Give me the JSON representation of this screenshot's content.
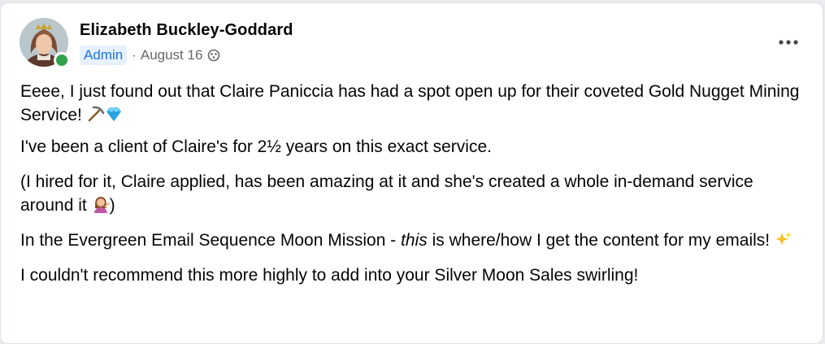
{
  "post": {
    "author": {
      "name": "Elizabeth Buckley-Goddard",
      "role_badge": "Admin",
      "date": "August 16",
      "separator": "·"
    },
    "paragraphs": {
      "p1": {
        "text": "Eeee, I just found out that Claire Paniccia has had a spot open up for their coveted Gold Nugget Mining Service!",
        "emojis": [
          "pick-icon",
          "gem-icon"
        ]
      },
      "p2": {
        "text": "I've been a client of Claire's for 2½ years on this exact service."
      },
      "p3": {
        "text": "(I hired for it, Claire applied, has been amazing at it and she's created a whole in-demand service around it",
        "close": ")",
        "emojis": [
          "woman-tipping-hand-icon"
        ]
      },
      "p4": {
        "before": "In the Evergreen Email Sequence Moon Mission - ",
        "italic": "this",
        "after": " is where/how I get the content for my emails!",
        "emojis": [
          "sparkles-icon"
        ]
      },
      "p5": {
        "text": "I couldn't recommend this more highly to add into your Silver Moon Sales swirling!"
      }
    }
  },
  "colors": {
    "admin_badge_bg": "#e7f0fd",
    "admin_badge_text": "#1b74e4",
    "online": "#31a24c",
    "meta_text": "#65676b"
  }
}
